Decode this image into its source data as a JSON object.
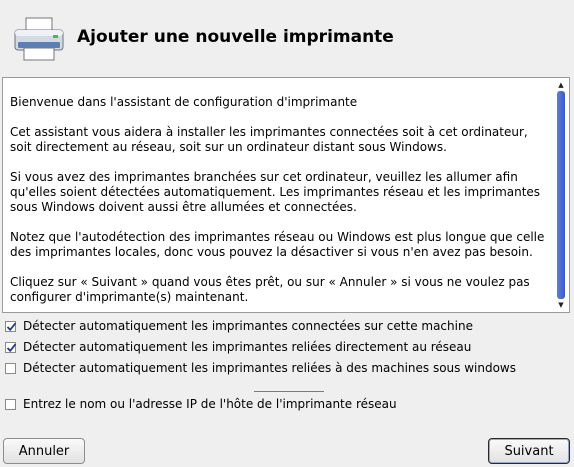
{
  "header": {
    "title": "Ajouter une nouvelle imprimante",
    "icon": "printer-icon"
  },
  "intro": {
    "paragraphs": [
      "Bienvenue dans l'assistant de configuration d'imprimante",
      "Cet assistant vous aidera à installer les imprimantes connectées soit à cet ordinateur, soit directement au réseau, soit sur un ordinateur distant sous Windows.",
      "Si vous avez des imprimantes branchées sur cet ordinateur, veuillez les allumer afin qu'elles soient détectées automatiquement. Les imprimantes réseau et les imprimantes sous Windows doivent aussi être allumées et connectées.",
      "Notez que l'autodétection des imprimantes réseau ou Windows est plus longue que celle des imprimantes locales, donc vous pouvez la désactiver si vous n'en avez pas besoin.",
      "Cliquez sur « Suivant » quand vous êtes prêt, ou sur « Annuler » si vous ne voulez pas configurer d'imprimante(s) maintenant."
    ]
  },
  "options": [
    {
      "label": "Détecter automatiquement les imprimantes connectées sur cette machine",
      "checked": true
    },
    {
      "label": "Détecter automatiquement les imprimantes reliées directement au réseau",
      "checked": true
    },
    {
      "label": "Détecter automatiquement les imprimantes reliées à des machines sous windows",
      "checked": false
    },
    {
      "label": "Entrez le nom ou l'adresse IP de l'hôte de l'imprimante réseau",
      "checked": false
    }
  ],
  "buttons": {
    "cancel": "Annuler",
    "next": "Suivant"
  },
  "colors": {
    "background": "#efefef",
    "scrollbar_accent": "#3b5cc9",
    "check_color": "#1f3a8a"
  }
}
